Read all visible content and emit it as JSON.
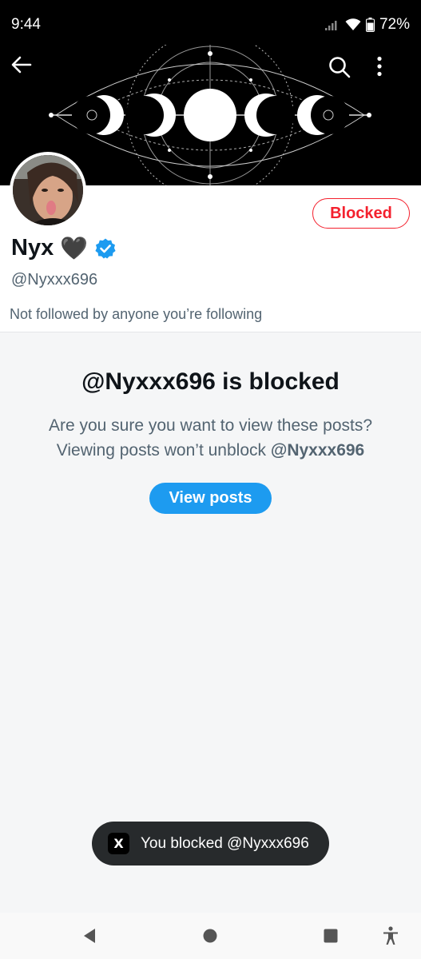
{
  "status_bar": {
    "time": "9:44",
    "battery": "72%"
  },
  "header": {
    "back_icon": "arrow-left-icon",
    "search_icon": "search-icon",
    "more_icon": "more-vertical-icon"
  },
  "profile": {
    "display_name": "Nyx",
    "name_emoji": "🖤",
    "handle": "@Nyxxx696",
    "followed_note": "Not followed by anyone you’re following",
    "blocked_button": "Blocked",
    "verified": true,
    "accent_color": "#1d9bf0",
    "blocked_color": "#f4212e"
  },
  "blocked_panel": {
    "title": "@Nyxxx696 is blocked",
    "desc_line1": "Are you sure you want to view these posts?",
    "desc_line2_prefix": "Viewing posts won’t unblock ",
    "desc_line2_handle": "@Nyxxx696",
    "view_posts_button": "View posts"
  },
  "toast": {
    "logo": "X",
    "message": "You blocked @Nyxxx696"
  },
  "nav_bar": {
    "items": [
      "back-triangle-icon",
      "home-circle-icon",
      "recents-square-icon",
      "accessibility-icon"
    ]
  }
}
